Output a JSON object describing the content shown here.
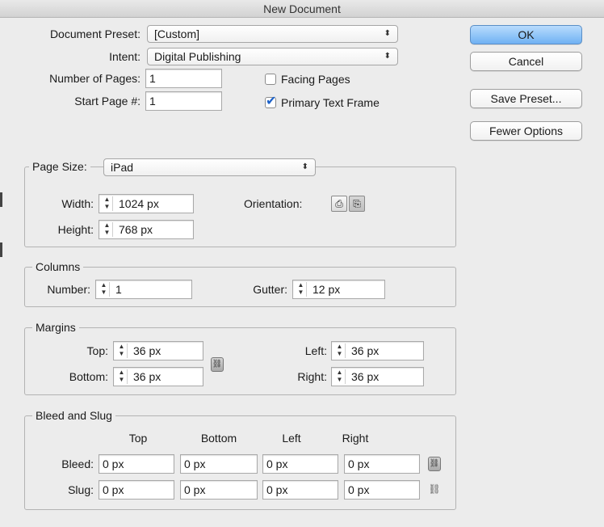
{
  "window": {
    "title": "New Document"
  },
  "document": {
    "preset_label": "Document Preset:",
    "preset_value": "[Custom]",
    "intent_label": "Intent:",
    "intent_value": "Digital Publishing",
    "pages_label": "Number of Pages:",
    "pages_value": "1",
    "start_page_label": "Start Page #:",
    "start_page_value": "1",
    "facing_pages_label": "Facing Pages",
    "facing_pages_checked": false,
    "primary_text_frame_label": "Primary Text Frame",
    "primary_text_frame_checked": true
  },
  "buttons": {
    "ok": "OK",
    "cancel": "Cancel",
    "save_preset": "Save Preset...",
    "fewer_options": "Fewer Options"
  },
  "page_size": {
    "label": "Page Size:",
    "value": "iPad",
    "width_label": "Width:",
    "width_value": "1024 px",
    "height_label": "Height:",
    "height_value": "768 px",
    "orientation_label": "Orientation:",
    "orientation_selected": "landscape"
  },
  "columns": {
    "legend": "Columns",
    "number_label": "Number:",
    "number_value": "1",
    "gutter_label": "Gutter:",
    "gutter_value": "12 px"
  },
  "margins": {
    "legend": "Margins",
    "top_label": "Top:",
    "top_value": "36 px",
    "bottom_label": "Bottom:",
    "bottom_value": "36 px",
    "left_label": "Left:",
    "left_value": "36 px",
    "right_label": "Right:",
    "right_value": "36 px"
  },
  "bleed_slug": {
    "legend": "Bleed and Slug",
    "headers": [
      "Top",
      "Bottom",
      "Left",
      "Right"
    ],
    "bleed_label": "Bleed:",
    "bleed_values": [
      "0 px",
      "0 px",
      "0 px",
      "0 px"
    ],
    "slug_label": "Slug:",
    "slug_values": [
      "0 px",
      "0 px",
      "0 px",
      "0 px"
    ]
  },
  "colors": {
    "accent": "#6fb1f3",
    "checkmark": "#1d62c9"
  }
}
